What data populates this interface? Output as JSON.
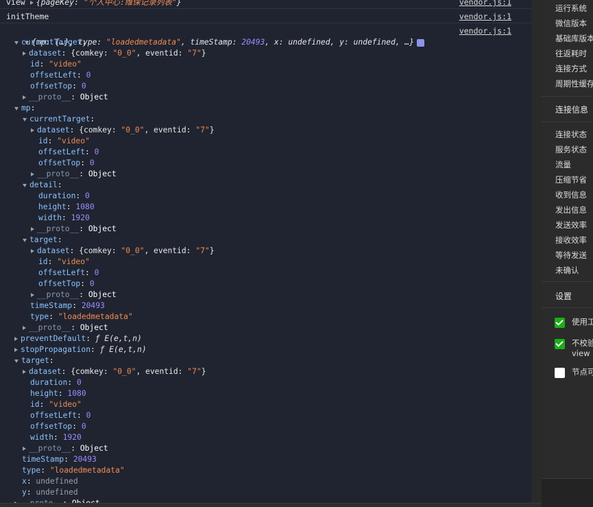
{
  "console": {
    "line_view": {
      "prefix": "view",
      "content": "{pageKey: ",
      "value": "\"个人中心:维保记录列表\"",
      "suffix": "}",
      "source": "vendor.js:1"
    },
    "line_init": {
      "text": "initTheme",
      "source": "vendor.js:1"
    },
    "event_summary": {
      "text": "{mp: {…}, type: ",
      "type_value": "\"loadedmetadata\"",
      "middle": ", timeStamp: ",
      "timestamp": "20493",
      "rest": ", x: undefined, y: undefined, …}",
      "source": "vendor.js:1"
    },
    "rows": [
      {
        "indent": 0,
        "tri": "down",
        "key": "currentTarget",
        "val": "",
        "vclass": ""
      },
      {
        "indent": 1,
        "tri": "right",
        "key": "dataset",
        "val": "{comkey: \"0_0\", eventid: \"7\"}",
        "vclass": "dataset"
      },
      {
        "indent": 1,
        "tri": "",
        "key": "id",
        "val": "\"video\"",
        "vclass": "str"
      },
      {
        "indent": 1,
        "tri": "",
        "key": "offsetLeft",
        "val": "0",
        "vclass": "num"
      },
      {
        "indent": 1,
        "tri": "",
        "key": "offsetTop",
        "val": "0",
        "vclass": "num"
      },
      {
        "indent": 1,
        "tri": "right",
        "key": "__proto__",
        "val": "Object",
        "vclass": "obj",
        "proto": true
      },
      {
        "indent": 0,
        "tri": "down",
        "key": "mp",
        "val": "",
        "vclass": ""
      },
      {
        "indent": 1,
        "tri": "down",
        "key": "currentTarget",
        "val": "",
        "vclass": ""
      },
      {
        "indent": 2,
        "tri": "right",
        "key": "dataset",
        "val": "{comkey: \"0_0\", eventid: \"7\"}",
        "vclass": "dataset"
      },
      {
        "indent": 2,
        "tri": "",
        "key": "id",
        "val": "\"video\"",
        "vclass": "str"
      },
      {
        "indent": 2,
        "tri": "",
        "key": "offsetLeft",
        "val": "0",
        "vclass": "num"
      },
      {
        "indent": 2,
        "tri": "",
        "key": "offsetTop",
        "val": "0",
        "vclass": "num"
      },
      {
        "indent": 2,
        "tri": "right",
        "key": "__proto__",
        "val": "Object",
        "vclass": "obj",
        "proto": true
      },
      {
        "indent": 1,
        "tri": "down",
        "key": "detail",
        "val": "",
        "vclass": ""
      },
      {
        "indent": 2,
        "tri": "",
        "key": "duration",
        "val": "0",
        "vclass": "num"
      },
      {
        "indent": 2,
        "tri": "",
        "key": "height",
        "val": "1080",
        "vclass": "num"
      },
      {
        "indent": 2,
        "tri": "",
        "key": "width",
        "val": "1920",
        "vclass": "num"
      },
      {
        "indent": 2,
        "tri": "right",
        "key": "__proto__",
        "val": "Object",
        "vclass": "obj",
        "proto": true
      },
      {
        "indent": 1,
        "tri": "down",
        "key": "target",
        "val": "",
        "vclass": ""
      },
      {
        "indent": 2,
        "tri": "right",
        "key": "dataset",
        "val": "{comkey: \"0_0\", eventid: \"7\"}",
        "vclass": "dataset"
      },
      {
        "indent": 2,
        "tri": "",
        "key": "id",
        "val": "\"video\"",
        "vclass": "str"
      },
      {
        "indent": 2,
        "tri": "",
        "key": "offsetLeft",
        "val": "0",
        "vclass": "num"
      },
      {
        "indent": 2,
        "tri": "",
        "key": "offsetTop",
        "val": "0",
        "vclass": "num"
      },
      {
        "indent": 2,
        "tri": "right",
        "key": "__proto__",
        "val": "Object",
        "vclass": "obj",
        "proto": true
      },
      {
        "indent": 1,
        "tri": "",
        "key": "timeStamp",
        "val": "20493",
        "vclass": "num"
      },
      {
        "indent": 1,
        "tri": "",
        "key": "type",
        "val": "\"loadedmetadata\"",
        "vclass": "str"
      },
      {
        "indent": 1,
        "tri": "right",
        "key": "__proto__",
        "val": "Object",
        "vclass": "obj",
        "proto": true
      },
      {
        "indent": 0,
        "tri": "right",
        "key": "preventDefault",
        "val": "ƒ E(e,t,n)",
        "vclass": "fn"
      },
      {
        "indent": 0,
        "tri": "right",
        "key": "stopPropagation",
        "val": "ƒ E(e,t,n)",
        "vclass": "fn"
      },
      {
        "indent": 0,
        "tri": "down",
        "key": "target",
        "val": "",
        "vclass": ""
      },
      {
        "indent": 1,
        "tri": "right",
        "key": "dataset",
        "val": "{comkey: \"0_0\", eventid: \"7\"}",
        "vclass": "dataset"
      },
      {
        "indent": 1,
        "tri": "",
        "key": "duration",
        "val": "0",
        "vclass": "num"
      },
      {
        "indent": 1,
        "tri": "",
        "key": "height",
        "val": "1080",
        "vclass": "num"
      },
      {
        "indent": 1,
        "tri": "",
        "key": "id",
        "val": "\"video\"",
        "vclass": "str"
      },
      {
        "indent": 1,
        "tri": "",
        "key": "offsetLeft",
        "val": "0",
        "vclass": "num"
      },
      {
        "indent": 1,
        "tri": "",
        "key": "offsetTop",
        "val": "0",
        "vclass": "num"
      },
      {
        "indent": 1,
        "tri": "",
        "key": "width",
        "val": "1920",
        "vclass": "num"
      },
      {
        "indent": 1,
        "tri": "right",
        "key": "__proto__",
        "val": "Object",
        "vclass": "obj",
        "proto": true
      },
      {
        "indent": 0,
        "tri": "",
        "key": "timeStamp",
        "val": "20493",
        "vclass": "num"
      },
      {
        "indent": 0,
        "tri": "",
        "key": "type",
        "val": "\"loadedmetadata\"",
        "vclass": "str"
      },
      {
        "indent": 0,
        "tri": "",
        "key": "x",
        "val": "undefined",
        "vclass": "undef"
      },
      {
        "indent": 0,
        "tri": "",
        "key": "y",
        "val": "undefined",
        "vclass": "undef"
      },
      {
        "indent": 0,
        "tri": "right",
        "key": "__proto__",
        "val": "Object",
        "vclass": "obj",
        "proto": true
      }
    ]
  },
  "panel": {
    "top_labels": [
      "运行系统",
      "微信版本",
      "基础库版本",
      "往返耗时",
      "连接方式",
      "周期性缓存"
    ],
    "connection_title": "连接信息",
    "connection_labels": [
      "连接状态",
      "服务状态",
      "流量",
      "压缩节省",
      "收到信息",
      "发出信息",
      "发送效率",
      "接收效率",
      "等待发送",
      "未确认"
    ],
    "settings_title": "设置",
    "settings": [
      {
        "label": "使用工",
        "checked": true
      },
      {
        "label": "不校验",
        "label2": "view",
        "checked": true
      },
      {
        "label": "节点可",
        "checked": false
      }
    ]
  },
  "colors": {
    "console_bg": "#1f2430",
    "key": "#8ec2ff",
    "string": "#f28b54",
    "number": "#9d8cff",
    "checkbox": "#1aad19"
  }
}
